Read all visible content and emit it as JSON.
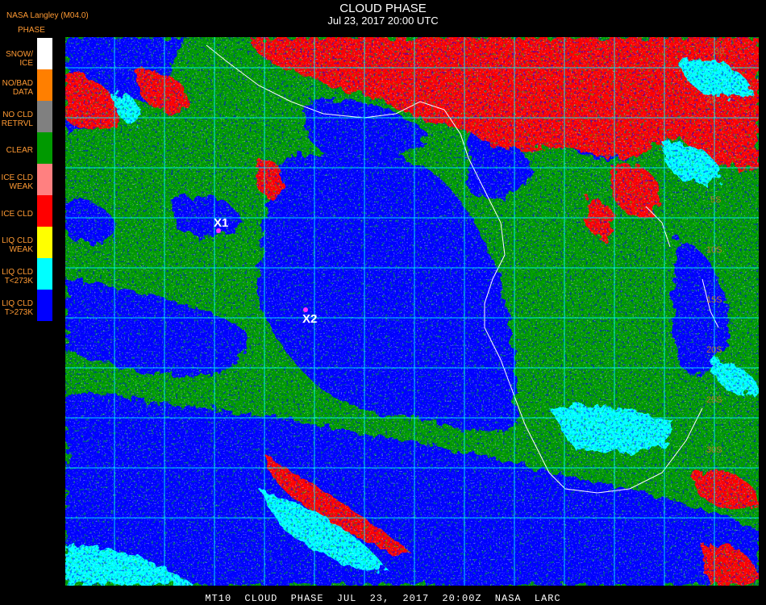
{
  "header": {
    "org": "NASA Langley (M04.0)",
    "title": "CLOUD PHASE",
    "subtitle": "Jul 23, 2017 20:00 UTC"
  },
  "legend": {
    "title": "PHASE",
    "items": [
      {
        "label": "SNOW/\nICE",
        "color": "#ffffff"
      },
      {
        "label": "NO/BAD\nDATA",
        "color": "#ff7f00"
      },
      {
        "label": "NO CLD\nRETRVL",
        "color": "#808080"
      },
      {
        "label": "CLEAR",
        "color": "#009900"
      },
      {
        "label": "ICE CLD\nWEAK",
        "color": "#ff8080"
      },
      {
        "label": "ICE CLD",
        "color": "#ff0000"
      },
      {
        "label": "LIQ CLD\nWEAK",
        "color": "#ffff00"
      },
      {
        "label": "LIQ CLD\nT<273K",
        "color": "#00ffff"
      },
      {
        "label": "LIQ CLD\nT>273K",
        "color": "#0000ff"
      }
    ]
  },
  "map": {
    "grid_color": "#00ffff",
    "coast_color": "#ffffff",
    "lat_labels": [
      "30",
      "25",
      "5S",
      "10S",
      "15S",
      "20S",
      "25S",
      "30S"
    ],
    "markers": [
      {
        "label": "X1"
      },
      {
        "label": "X2"
      }
    ]
  },
  "footer": {
    "text": "MT10 CLOUD PHASE JUL 23, 2017 20:00Z NASA LARC"
  }
}
